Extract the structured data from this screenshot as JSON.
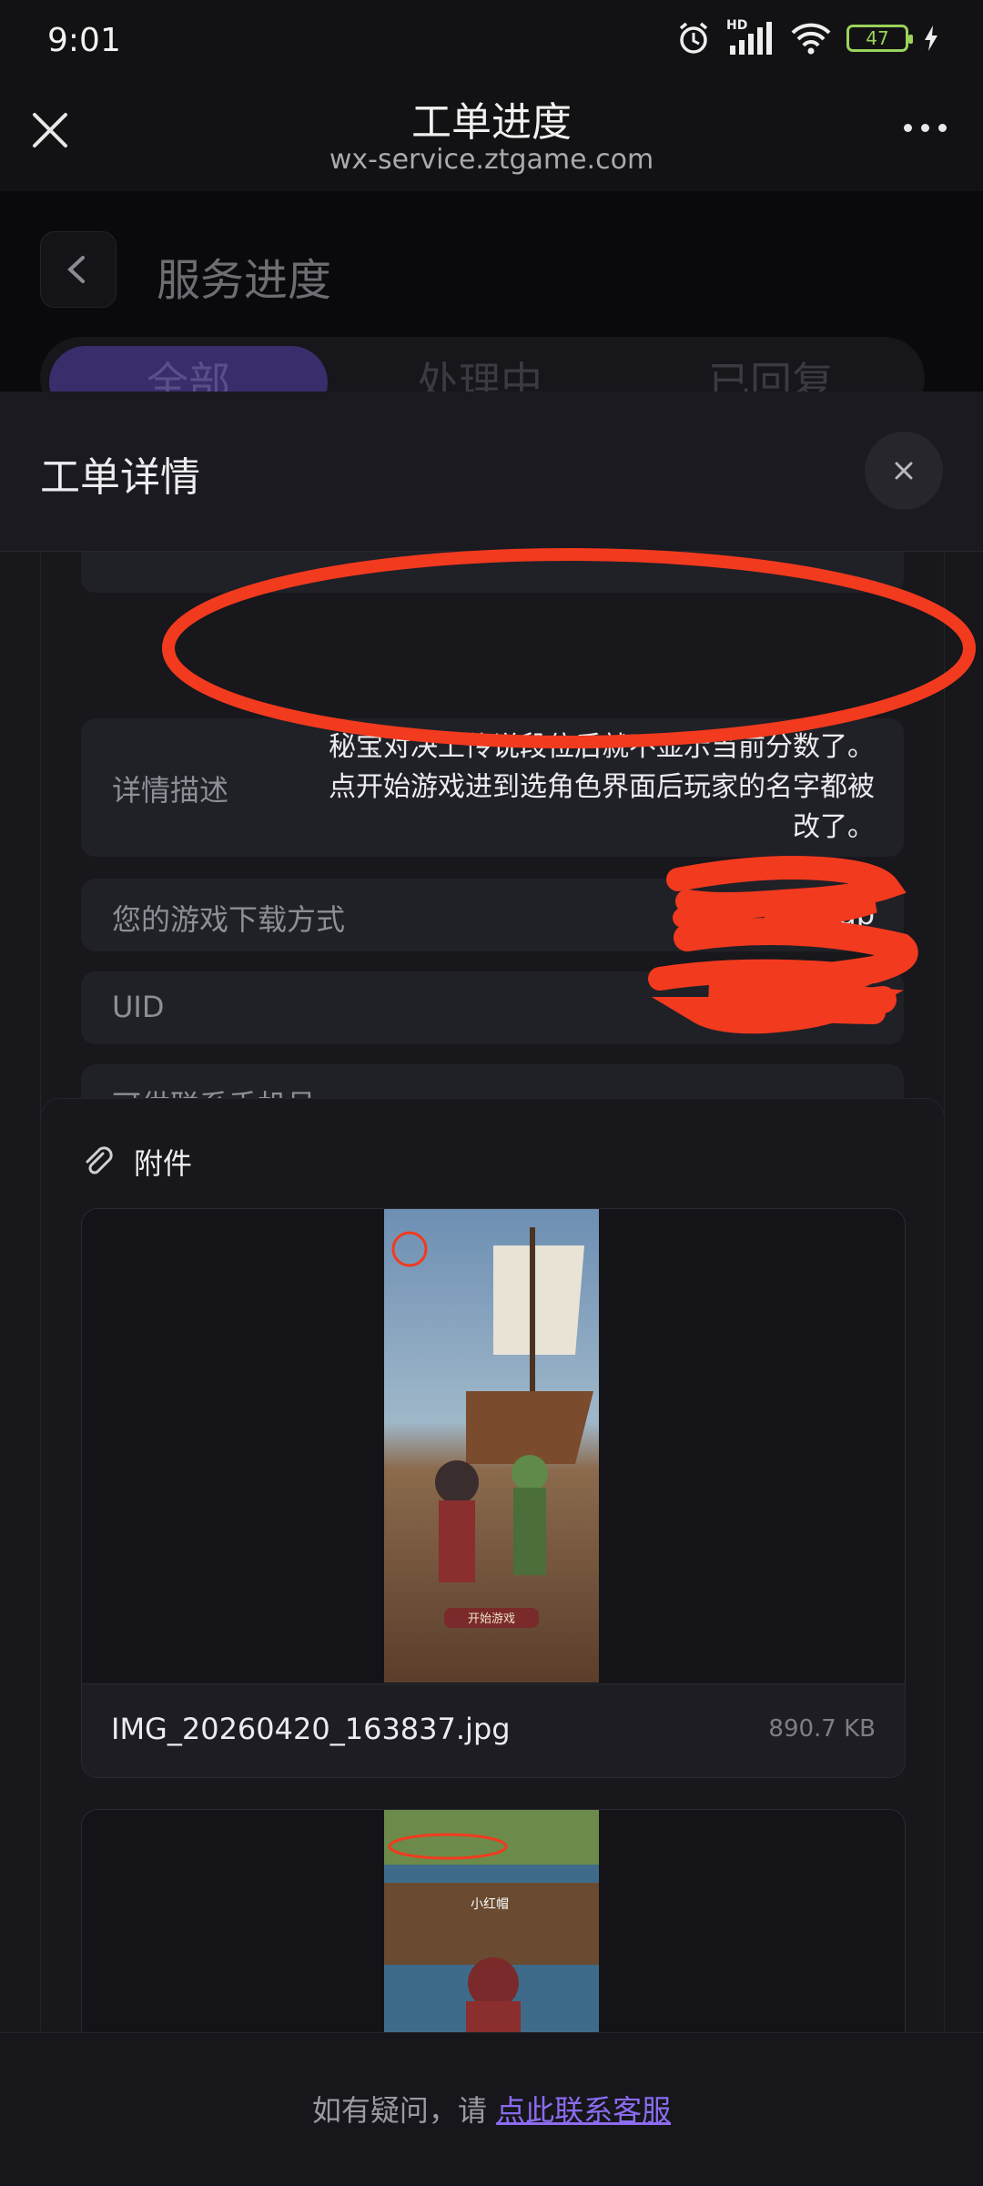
{
  "status": {
    "time": "9:01",
    "network": "HD",
    "battery": "47"
  },
  "header": {
    "title": "工单进度",
    "subtitle": "wx-service.ztgame.com"
  },
  "background": {
    "page_title": "服务进度",
    "tabs": [
      {
        "label": "全部"
      },
      {
        "label": "处理中"
      },
      {
        "label": "已回复"
      }
    ]
  },
  "sheet": {
    "title": "工单详情",
    "description_label": "详情描述",
    "description_lines": [
      "秘宝对决上传说段位后就不显示当前分数了。",
      "点开始游戏进到选角色界面后玩家的名字都被",
      "改了。"
    ],
    "fields": [
      {
        "label": "您的游戏下载方式",
        "value": "taptap"
      },
      {
        "label": "UID",
        "value": ""
      },
      {
        "label": "可供联系手机号",
        "value": ""
      }
    ],
    "attachments_title": "附件",
    "attachments": [
      {
        "file_name": "IMG_20260420_163837.jpg",
        "file_size": "890.7 KB",
        "overlay_text": "开始游戏"
      },
      {
        "file_name": "",
        "file_size": "",
        "overlay_text": "小红帽"
      }
    ]
  },
  "footer": {
    "text": "如有疑问，请",
    "link": "点此联系客服"
  },
  "colors": {
    "accent": "#8c6cf0",
    "annotation": "#f23a1e",
    "background": "#16161b"
  }
}
